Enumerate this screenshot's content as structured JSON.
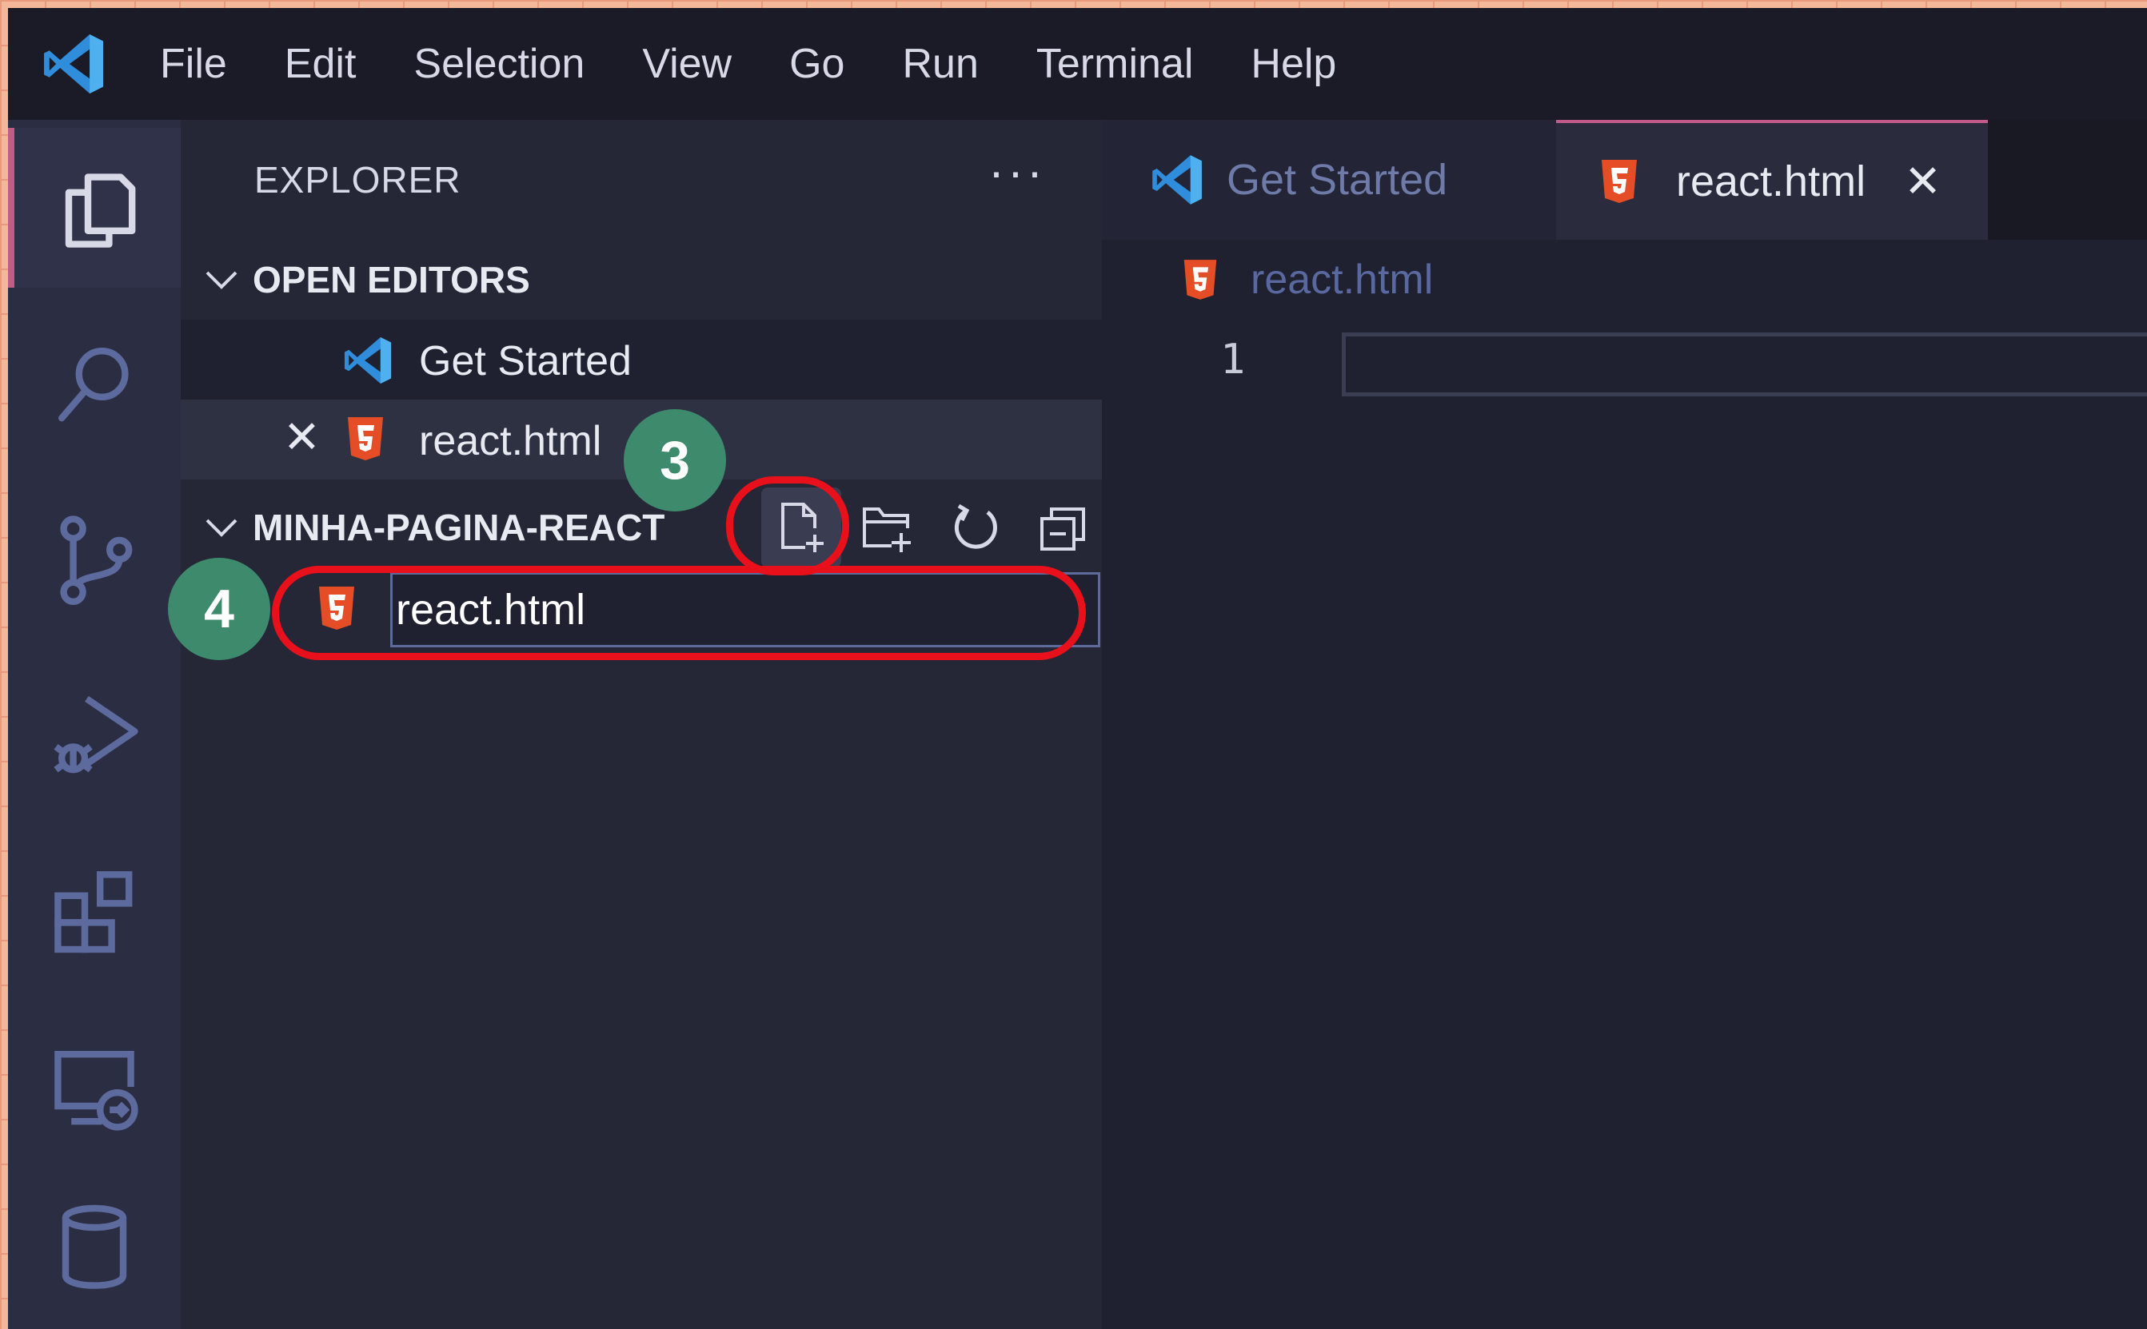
{
  "menu": {
    "items": [
      "File",
      "Edit",
      "Selection",
      "View",
      "Go",
      "Run",
      "Terminal",
      "Help"
    ]
  },
  "activity_bar": {
    "icons": [
      "explorer-icon",
      "search-icon",
      "source-control-icon",
      "run-debug-icon",
      "extensions-icon",
      "remote-explorer-icon",
      "database-icon"
    ]
  },
  "sidebar": {
    "title": "EXPLORER",
    "more": "···",
    "open_editors": {
      "title": "OPEN EDITORS",
      "items": [
        {
          "label": "Get Started"
        },
        {
          "label": "react.html",
          "close": "✕"
        }
      ]
    },
    "folder": {
      "title": "MINHA-PAGINA-REACT",
      "toolbar": [
        "new-file-icon",
        "new-folder-icon",
        "refresh-icon",
        "collapse-all-icon"
      ],
      "new_file_value": "react.html"
    }
  },
  "tabs": [
    {
      "label": "Get Started",
      "active": false
    },
    {
      "label": "react.html",
      "active": true,
      "close": "✕"
    }
  ],
  "breadcrumb": {
    "file": "react.html"
  },
  "editor": {
    "line_number": "1"
  },
  "annotations": [
    {
      "label": "3"
    },
    {
      "label": "4"
    }
  ],
  "colors": {
    "html_icon": "#e44d26",
    "vscode_blue": "#3c99dc",
    "callout_green": "#3d8a6c",
    "callout_red": "#e8101a"
  }
}
